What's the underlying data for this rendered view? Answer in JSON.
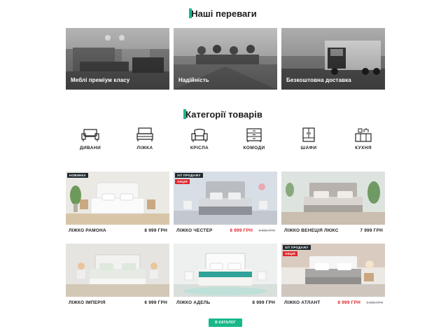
{
  "advantages": {
    "title": "Наші переваги",
    "items": [
      {
        "label": "Меблі преміум класу"
      },
      {
        "label": "Надійність"
      },
      {
        "label": "Безкоштовна доставка"
      }
    ]
  },
  "categories": {
    "title": "Категорії товарів",
    "items": [
      {
        "label": "ДИВАНИ",
        "icon": "sofa-icon"
      },
      {
        "label": "ЛІЖКА",
        "icon": "bed-icon"
      },
      {
        "label": "КРІСЛА",
        "icon": "armchair-icon"
      },
      {
        "label": "КОМОДИ",
        "icon": "dresser-icon"
      },
      {
        "label": "ШАФИ",
        "icon": "wardrobe-icon"
      },
      {
        "label": "КУХНЯ",
        "icon": "kitchen-icon"
      }
    ]
  },
  "products": [
    {
      "name": "ЛІЖКО РАМОНА",
      "price": "8 999 ГРН",
      "old_price": "",
      "badges": [
        "НОВИНКА"
      ]
    },
    {
      "name": "ЛІЖКО ЧЕСТЕР",
      "price": "8 999 ГРН",
      "old_price": "9 999 ГРН",
      "badges": [
        "ХІТ ПРОДАЖУ",
        "АКЦІЯ"
      ]
    },
    {
      "name": "ЛІЖКО ВЕНЕЦІЯ ЛЮКС",
      "price": "7 999 ГРН",
      "old_price": "",
      "badges": []
    },
    {
      "name": "ЛІЖКО ІМПЕРІЯ",
      "price": "6 999 ГРН",
      "old_price": "",
      "badges": []
    },
    {
      "name": "ЛІЖКО АДЕЛЬ",
      "price": "8 999 ГРН",
      "old_price": "",
      "badges": []
    },
    {
      "name": "ЛІЖКО АТЛАНТ",
      "price": "8 999 ГРН",
      "old_price": "9 999 ГРН",
      "badges": [
        "ХІТ ПРОДАЖУ",
        "АКЦІЯ"
      ]
    }
  ],
  "catalog_button": "В КАТАЛОГ",
  "colors": {
    "accent": "#17b88a",
    "sale": "#e0262d",
    "badge_dark": "#1f2a2e"
  }
}
